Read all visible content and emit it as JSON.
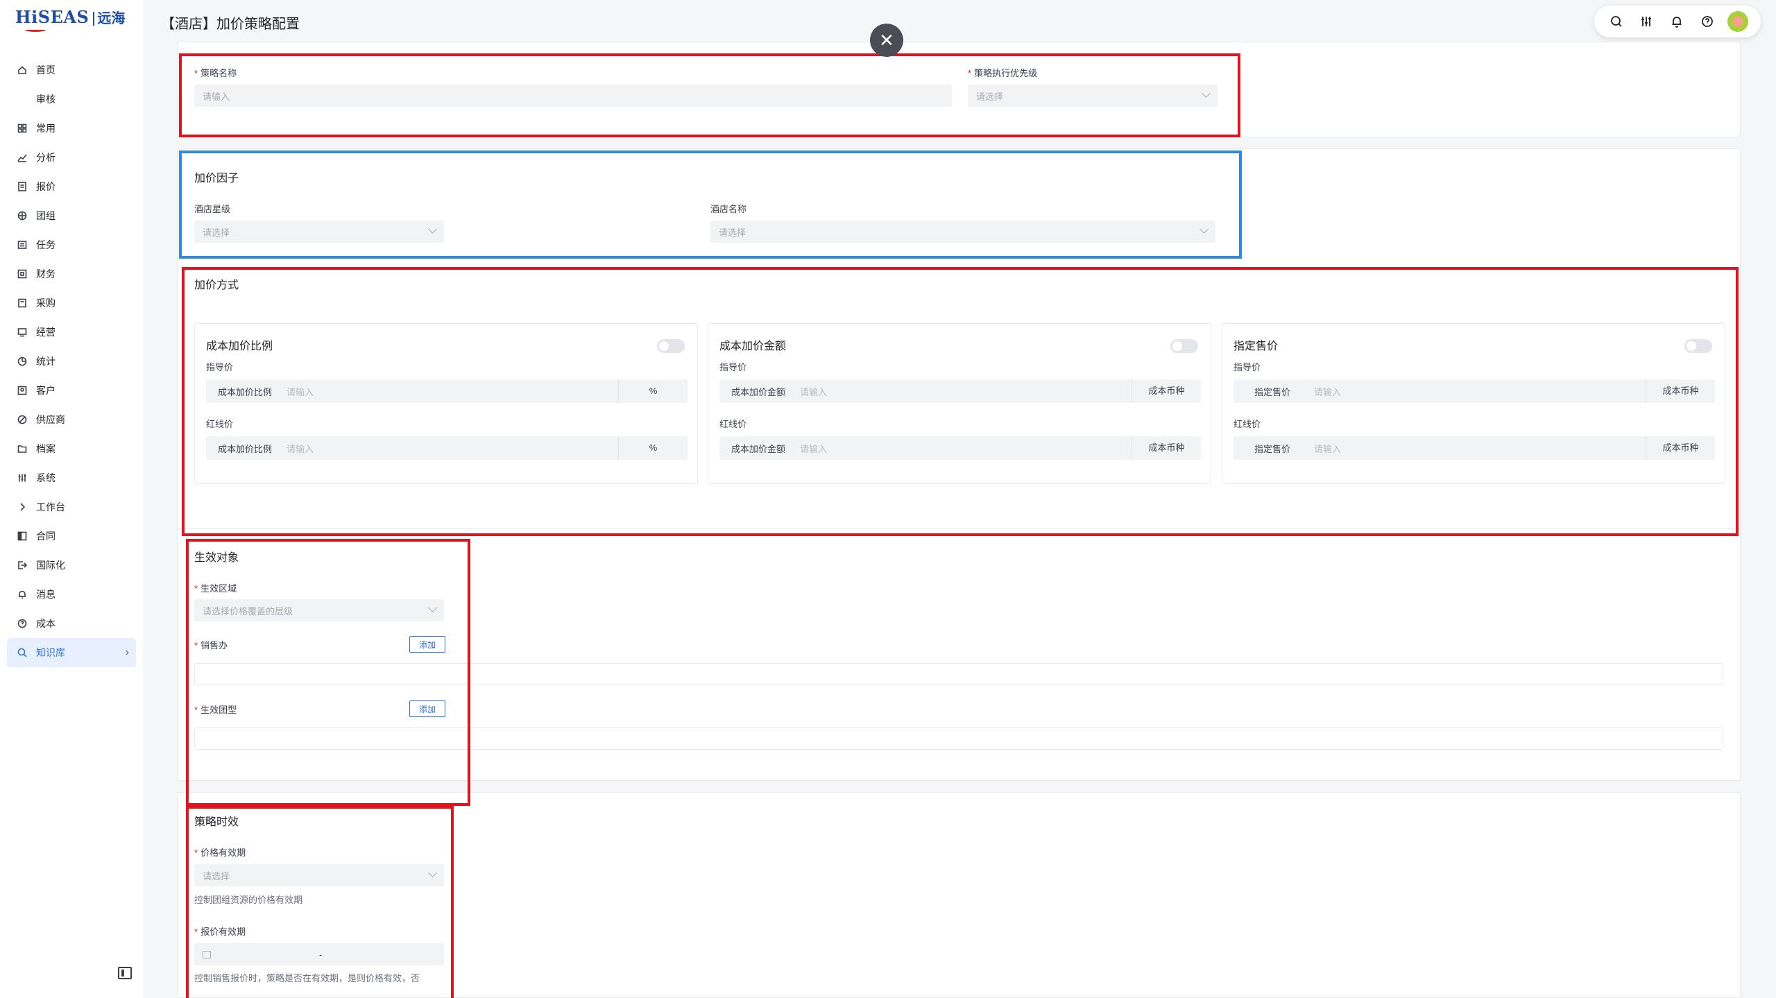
{
  "brand": {
    "name": "HiSEAS",
    "sub": "远海"
  },
  "sidebar": {
    "items": [
      {
        "label": "首页",
        "icon": "home-icon"
      },
      {
        "label": "审核",
        "icon": ""
      },
      {
        "label": "常用",
        "icon": "apps-icon"
      },
      {
        "label": "分析",
        "icon": "chart-icon"
      },
      {
        "label": "报价",
        "icon": "quote-icon"
      },
      {
        "label": "团组",
        "icon": "group-icon"
      },
      {
        "label": "任务",
        "icon": "task-icon"
      },
      {
        "label": "财务",
        "icon": "finance-icon"
      },
      {
        "label": "采购",
        "icon": "purchase-icon"
      },
      {
        "label": "经营",
        "icon": "operation-icon"
      },
      {
        "label": "统计",
        "icon": "pie-icon"
      },
      {
        "label": "客户",
        "icon": "customer-icon"
      },
      {
        "label": "供应商",
        "icon": "supplier-icon"
      },
      {
        "label": "档案",
        "icon": "folder-icon"
      },
      {
        "label": "系统",
        "icon": "settings-icon"
      },
      {
        "label": "工作台",
        "icon": "chevron-right-icon"
      },
      {
        "label": "合同",
        "icon": "contract-icon"
      },
      {
        "label": "国际化",
        "icon": "export-icon"
      },
      {
        "label": "消息",
        "icon": "bell-icon"
      },
      {
        "label": "成本",
        "icon": "help-icon"
      },
      {
        "label": "知识库",
        "icon": "search-icon"
      }
    ],
    "active_index": 20
  },
  "header": {
    "title": "【酒店】加价策略配置"
  },
  "basic": {
    "name_label": "策略名称",
    "name_placeholder": "请输入",
    "priority_label": "策略执行优先级",
    "priority_placeholder": "请选择"
  },
  "factor": {
    "title": "加价因子",
    "star_label": "酒店星级",
    "star_placeholder": "请选择",
    "hotel_label": "酒店名称",
    "hotel_placeholder": "请选择"
  },
  "method": {
    "title": "加价方式",
    "cards": [
      {
        "title": "成本加价比例",
        "guide_label": "指导价",
        "red_label": "红线价",
        "prefix": "成本加价比例",
        "placeholder": "请输入",
        "suffix": "%"
      },
      {
        "title": "成本加价金额",
        "guide_label": "指导价",
        "red_label": "红线价",
        "prefix": "成本加价金额",
        "placeholder": "请输入",
        "suffix": "成本币种"
      },
      {
        "title": "指定售价",
        "guide_label": "指导价",
        "red_label": "红线价",
        "prefix": "指定售价",
        "placeholder": "请输入",
        "suffix": "成本币种"
      }
    ]
  },
  "target": {
    "title": "生效对象",
    "region_label": "生效区域",
    "region_placeholder": "请选择价格覆盖的层级",
    "office_label": "销售办",
    "office_add": "添加",
    "group_label": "生效团型",
    "group_add": "添加"
  },
  "timing": {
    "title": "策略时效",
    "price_valid_label": "价格有效期",
    "price_valid_placeholder": "请选择",
    "price_valid_hint": "控制团组资源的价格有效期",
    "quote_valid_label": "报价有效期",
    "quote_valid_sep": "-",
    "quote_valid_hint": "控制销售报价时，策略是否在有效期，是则价格有效，否"
  },
  "colors": {
    "highlight_red": "#e0141e",
    "highlight_blue": "#2b8de0",
    "accent": "#2f6fe4"
  }
}
